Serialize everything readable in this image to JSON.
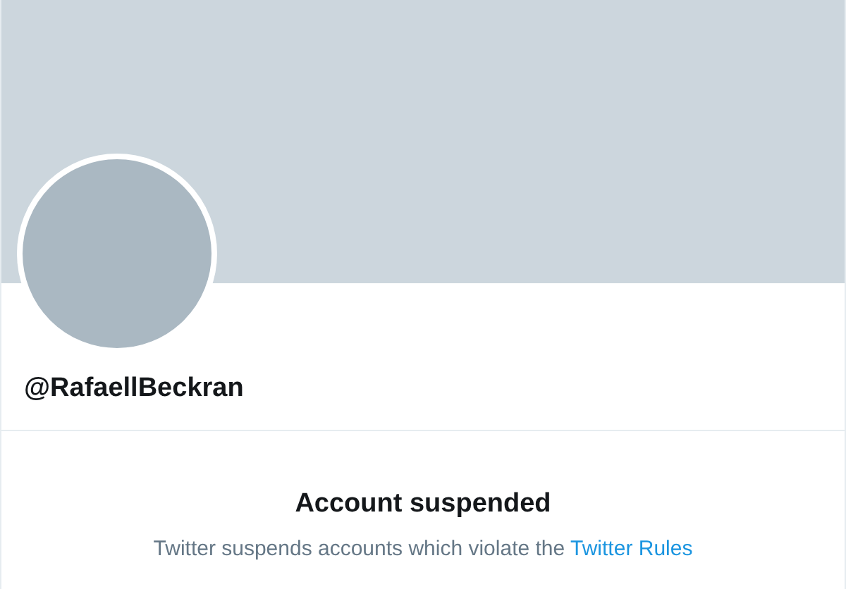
{
  "profile": {
    "handle": "@RafaellBeckran"
  },
  "notice": {
    "title": "Account suspended",
    "text": "Twitter suspends accounts which violate the",
    "link": "Twitter Rules"
  }
}
